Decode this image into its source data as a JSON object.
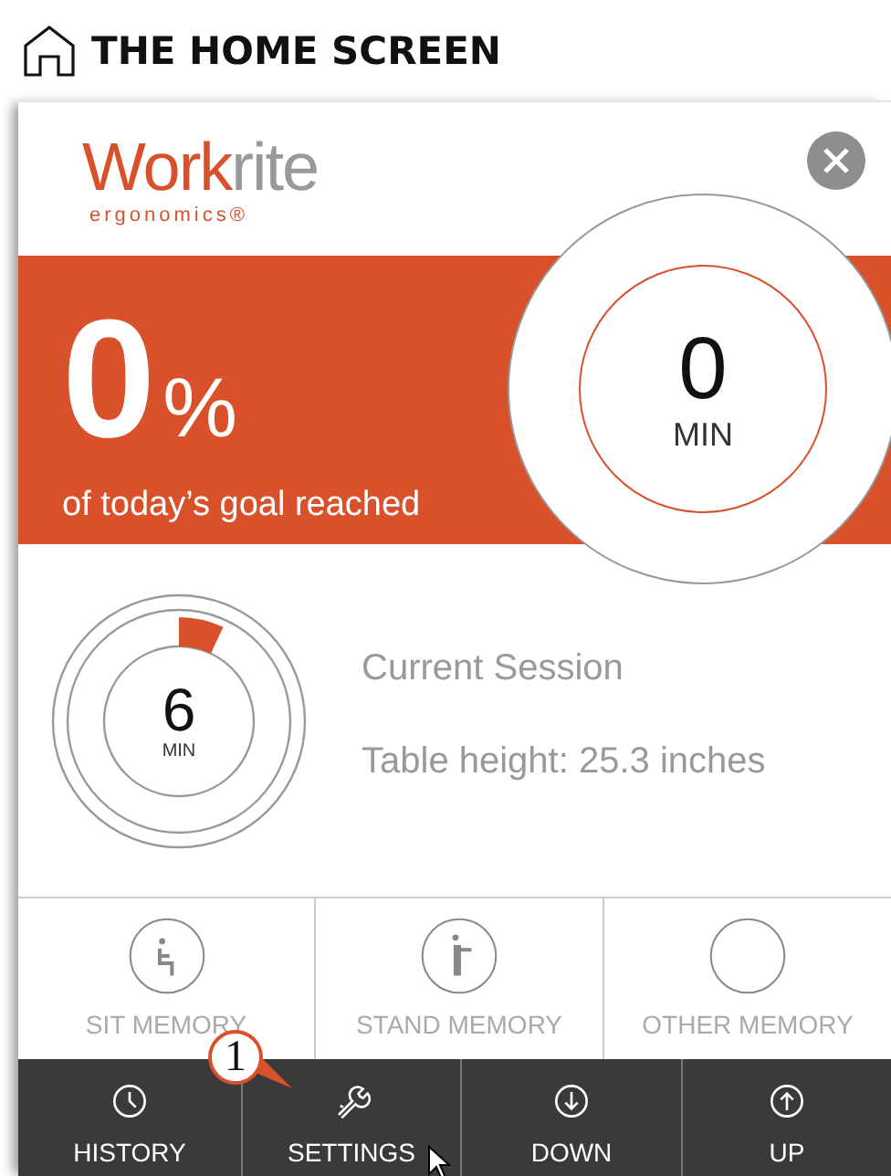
{
  "page_title": "THE HOME SCREEN",
  "logo": {
    "primary": "Work",
    "secondary": "rite",
    "tagline": "ergonomics®"
  },
  "daily_goal": {
    "percent": "0",
    "percent_sign": "%",
    "caption": "of today’s goal reached",
    "minutes": "0",
    "unit": "MIN"
  },
  "session": {
    "minutes": "6",
    "unit": "MIN",
    "title": "Current Session",
    "table_height": "Table height: 25.3 inches"
  },
  "memory_buttons": [
    {
      "kind": "sit",
      "label": "SIT MEMORY"
    },
    {
      "kind": "stand",
      "label": "STAND MEMORY"
    },
    {
      "kind": "other",
      "label": "OTHER MEMORY"
    }
  ],
  "nav_buttons": [
    {
      "kind": "history",
      "label": "HISTORY"
    },
    {
      "kind": "settings",
      "label": "SETTINGS"
    },
    {
      "kind": "down",
      "label": "DOWN"
    },
    {
      "kind": "up",
      "label": "UP"
    }
  ],
  "callout": "1"
}
